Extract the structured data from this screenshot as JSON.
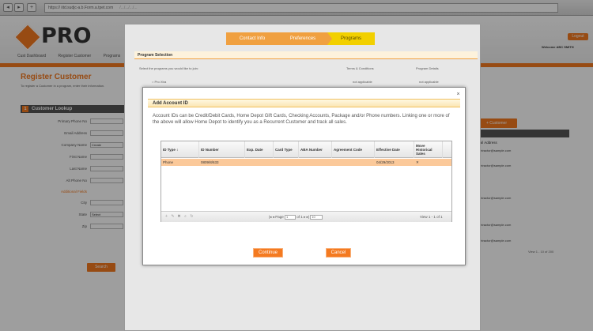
{
  "browser": {
    "back": "◂",
    "forward": "▸",
    "add": "+",
    "address": "https://  iitd.sudjc-a.b.Form.a.tpet.com",
    "address_suffix": "/.../.../.../..."
  },
  "site": {
    "logo": "PRO",
    "nav": [
      "Cust Dashboard",
      "Register Customer",
      "Programs"
    ],
    "logout_label": "Logout",
    "welcome": "Welcome ABC SMITH",
    "page_title": "Register Customer",
    "page_subtitle": "To register a Customer in a program, enter their information.",
    "section_number": "1",
    "section_title": "Customer Lookup",
    "fields": [
      {
        "label": "Primary Phone No",
        "value": ""
      },
      {
        "label": "Email Address",
        "value": ""
      },
      {
        "label": "Company Name",
        "value": "Create"
      },
      {
        "label": "First Name",
        "value": ""
      },
      {
        "label": "Last Name",
        "value": ""
      },
      {
        "label": "Alt Phone No",
        "value": ""
      },
      {
        "label": "Additional Fields",
        "value": ""
      },
      {
        "label": "City",
        "value": ""
      },
      {
        "label": "State",
        "value": "Select"
      },
      {
        "label": "Zip",
        "value": ""
      }
    ],
    "search_label": "Search",
    "add_customer_label": "+ Customer",
    "right_label": "Email Address",
    "right_rows": [
      "Contractor@sample.com",
      "Contractor@sample.com",
      "Contractor@sample.com",
      "Contractor@sample.com",
      "Contractor@sample.com"
    ],
    "right_footer": "View 1 - 10 of 200"
  },
  "wizard": {
    "steps": [
      "Contact Info",
      "Preferences",
      "Programs"
    ],
    "section_title": "Program Selection",
    "instruction": "Select the programs you would like to join:",
    "col_terms": "Terms & Conditions",
    "col_details": "Program Details",
    "option_label": "Pro Xtra",
    "not_applicable": "not applicable"
  },
  "dialog": {
    "title": "Add Account ID",
    "close": "×",
    "description": "Account IDs can be Credit/Debit Cards, Home Depot Gift Cards, Checking Accounts, Package and/or Phone numbers. Linking one or more of the above will allow Home Depot to identify you as a Recurrent Customer and track all sales.",
    "columns": [
      "ID Type ↕",
      "ID Number",
      "Exp. Date",
      "Card Type",
      "ABA Number",
      "Agreement Code",
      "Effective Date",
      "Move Historical Sales"
    ],
    "rows": [
      {
        "id_type": "Phone",
        "id_number": "0809/8/633",
        "exp_date": "",
        "card_type": "",
        "aba_number": "",
        "agreement_code": "",
        "effective_date": "04/29/2013",
        "move": "✕"
      }
    ],
    "pager": {
      "page_label": "Page",
      "page_value": "1",
      "of_label": "of 1",
      "per_page": "10",
      "view_info": "View 1 - 1 of 1"
    },
    "continue_label": "Continue",
    "cancel_label": "Cancel"
  }
}
